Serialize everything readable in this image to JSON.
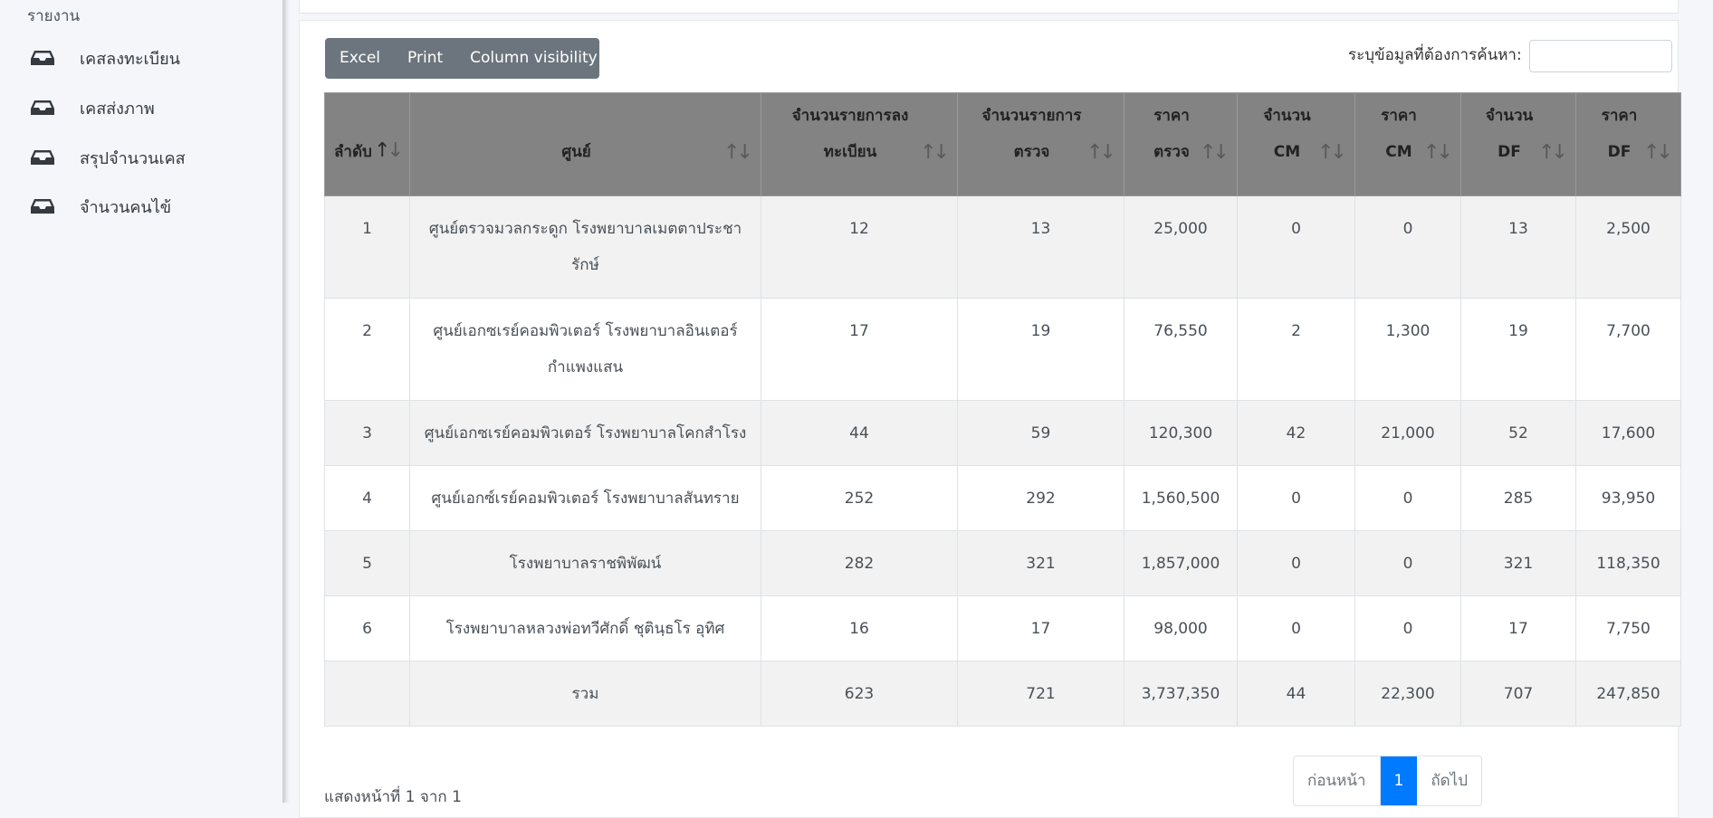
{
  "sidebar": {
    "header": "รายงาน",
    "items": [
      {
        "label": "เคสลงทะเบียน",
        "icon": "inbox-icon"
      },
      {
        "label": "เคสส่งภาพ",
        "icon": "inbox-icon"
      },
      {
        "label": "สรุปจำนวนเคส",
        "icon": "inbox-icon"
      },
      {
        "label": "จำนวนคนไข้",
        "icon": "inbox-icon"
      }
    ]
  },
  "toolbar": {
    "excel_label": "Excel",
    "print_label": "Print",
    "colvis_label": "Column visibility"
  },
  "search": {
    "label": "ระบุข้อมูลที่ต้องการค้นหา:",
    "value": "",
    "placeholder": ""
  },
  "table": {
    "headers": [
      [
        "ลำดับ"
      ],
      [
        "ศูนย์"
      ],
      [
        "จำนวนรายการลง",
        "ทะเบียน"
      ],
      [
        "จำนวนรายการ",
        "ตรวจ"
      ],
      [
        "ราคา",
        "ตรวจ"
      ],
      [
        "จำนวน",
        "CM"
      ],
      [
        "ราคา",
        "CM"
      ],
      [
        "จำนวน",
        "DF"
      ],
      [
        "ราคา",
        "DF"
      ]
    ],
    "rows": [
      [
        "1",
        "ศูนย์ตรวจมวลกระดูก โรงพยาบาลเมตตาประชา\nรักษ์",
        "12",
        "13",
        "25,000",
        "0",
        "0",
        "13",
        "2,500"
      ],
      [
        "2",
        "ศูนย์เอกซเรย์คอมพิวเตอร์ โรงพยาบาลอินเตอร์\nกำแพงแสน",
        "17",
        "19",
        "76,550",
        "2",
        "1,300",
        "19",
        "7,700"
      ],
      [
        "3",
        "ศูนย์เอกซเรย์คอมพิวเตอร์ โรงพยาบาลโคกสำโรง",
        "44",
        "59",
        "120,300",
        "42",
        "21,000",
        "52",
        "17,600"
      ],
      [
        "4",
        "ศูนย์เอกซ์เรย์คอมพิวเตอร์ โรงพยาบาลสันทราย",
        "252",
        "292",
        "1,560,500",
        "0",
        "0",
        "285",
        "93,950"
      ],
      [
        "5",
        "โรงพยาบาลราชพิพัฒน์",
        "282",
        "321",
        "1,857,000",
        "0",
        "0",
        "321",
        "118,350"
      ],
      [
        "6",
        "โรงพยาบาลหลวงพ่อทวีศักดิ์ ชุตินฺธโร อุทิศ",
        "16",
        "17",
        "98,000",
        "0",
        "0",
        "17",
        "7,750"
      ],
      [
        "",
        "รวม",
        "623",
        "721",
        "3,737,350",
        "44",
        "22,300",
        "707",
        "247,850"
      ]
    ]
  },
  "footer": {
    "info": "แสดงหน้าที่ 1 จาก 1",
    "prev_label": "ก่อนหน้า",
    "current_page": "1",
    "next_label": "ถัดไป"
  },
  "colors": {
    "header_bg": "#838383",
    "accent": "#007bff",
    "button_bg": "#6c757d"
  }
}
